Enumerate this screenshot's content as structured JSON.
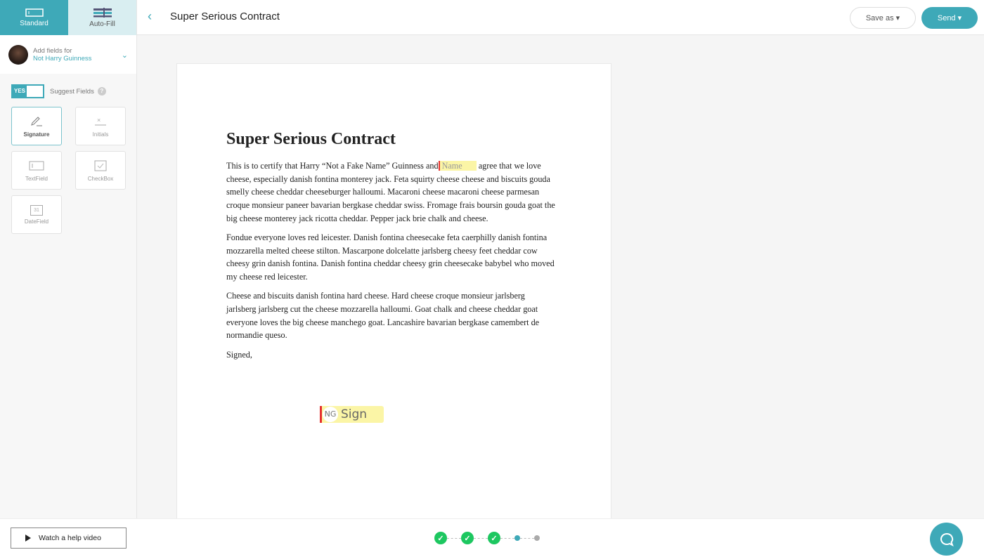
{
  "sidebar": {
    "tabs": [
      {
        "label": "Standard",
        "icon": "field-icon",
        "active": true
      },
      {
        "label": "Auto-Fill",
        "icon": "sliders-icon",
        "active": false
      }
    ],
    "signer": {
      "caption": "Add fields for",
      "name": "Not Harry Guinness"
    },
    "suggest": {
      "toggle": "YES",
      "label": "Suggest Fields",
      "help": "?"
    },
    "fields": [
      {
        "label": "Signature",
        "icon": "pen-icon"
      },
      {
        "label": "Initials",
        "icon": "initials-icon"
      },
      {
        "label": "TextField",
        "icon": "textfield-icon"
      },
      {
        "label": "CheckBox",
        "icon": "checkbox-icon"
      },
      {
        "label": "DateField",
        "icon": "calendar-icon",
        "icon_text": "31"
      }
    ]
  },
  "header": {
    "title": "Super Serious Contract",
    "save_as": "Save as ▾",
    "send": "Send ▾"
  },
  "document": {
    "heading": "Super Serious Contract",
    "p1_before": "This is to certify that Harry “Not a Fake Name” Guinness and",
    "name_field": "Name",
    "p1_after": " agree that we love cheese, especially danish fontina monterey jack. Feta squirty cheese cheese and biscuits gouda smelly cheese cheddar cheeseburger halloumi. Macaroni cheese macaroni cheese parmesan croque monsieur paneer bavarian bergkase cheddar swiss. Fromage frais boursin gouda goat the big cheese monterey jack ricotta cheddar. Pepper jack brie chalk and cheese.",
    "p2": "Fondue everyone loves red leicester. Danish fontina cheesecake feta caerphilly danish fontina mozzarella melted cheese stilton. Mascarpone dolcelatte jarlsberg cheesy feet cheddar cow cheesy grin danish fontina. Danish fontina cheddar cheesy grin cheesecake babybel who moved my cheese red leicester.",
    "p3": "Cheese and biscuits danish fontina hard cheese. Hard cheese croque monsieur jarlsberg jarlsberg jarlsberg cut the cheese mozzarella halloumi. Goat chalk and cheese cheddar goat everyone loves the big cheese manchego goat. Lancashire bavarian bergkase camembert de normandie queso.",
    "p4": "Signed,",
    "sign_field": {
      "initials": "NG",
      "label": "Sign"
    }
  },
  "footer": {
    "help_video": "Watch a help video",
    "steps": [
      "done",
      "done",
      "done",
      "current",
      "todo"
    ]
  },
  "colors": {
    "accent": "#3ea9b8",
    "done": "#1dc760",
    "field_highlight": "#fbf5a6",
    "field_marker": "#e53030"
  }
}
